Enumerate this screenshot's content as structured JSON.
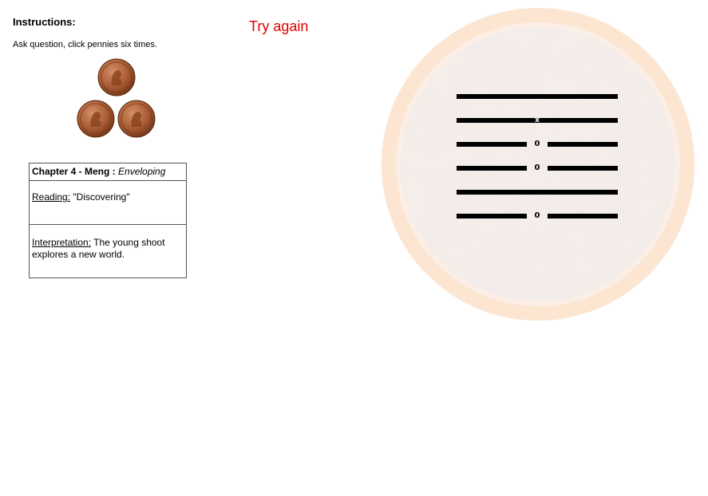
{
  "instructions": {
    "title": "Instructions:",
    "text": "Ask question, click pennies six times."
  },
  "try_again": "Try again",
  "pennies": [
    {
      "icon": "penny-icon"
    },
    {
      "icon": "penny-icon"
    },
    {
      "icon": "penny-icon"
    }
  ],
  "reading": {
    "chapter_prefix": "Chapter 4 - Meng :",
    "chapter_name": "Enveloping",
    "reading_label": "Reading:",
    "reading_value": "\"Discovering\"",
    "interpretation_label": "Interpretation:",
    "interpretation_value": "The young shoot explores a new world."
  },
  "hexagram": {
    "lines_top_to_bottom": [
      {
        "type": "solid",
        "marker": ""
      },
      {
        "type": "solid",
        "marker": "x"
      },
      {
        "type": "broken",
        "marker": "0"
      },
      {
        "type": "broken",
        "marker": "0"
      },
      {
        "type": "solid",
        "marker": ""
      },
      {
        "type": "broken",
        "marker": "0"
      }
    ]
  },
  "colors": {
    "try_again": "#e00000",
    "ring": "#fce2cc",
    "line": "#000000"
  }
}
